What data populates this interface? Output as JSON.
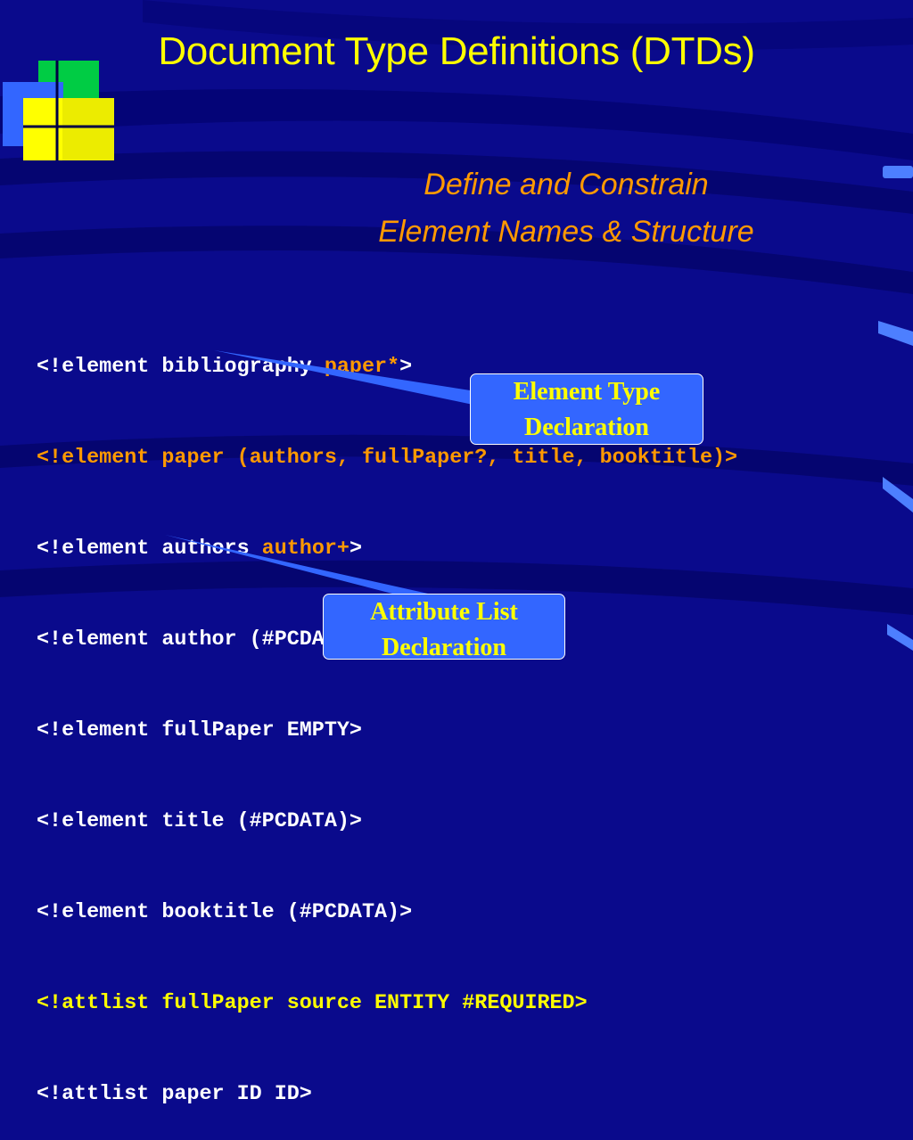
{
  "slide": {
    "title": "Document Type Definitions (DTDs)",
    "subtitle_line1": "Define and Constrain",
    "subtitle_line2": "Element Names & Structure"
  },
  "code": {
    "line1_prefix": "<!element bibliography ",
    "line1_highlight": "paper*",
    "line1_suffix": ">",
    "line2": "<!element paper (authors, fullPaper?, title, booktitle)>",
    "line3_prefix": "<!element authors ",
    "line3_highlight": "author+",
    "line3_suffix": ">",
    "line4": "<!element author (#PCDATA)>",
    "line5": "<!element fullPaper EMPTY>",
    "line6": "<!element title (#PCDATA)>",
    "line7": "<!element booktitle (#PCDATA)>",
    "line8_p1": "<!attlist fullPaper source ",
    "line8_p2": "ENTITY #REQUIRED>",
    "line9": "<!attlist paper ID ID>"
  },
  "callouts": {
    "element_type_line1": "Element Type",
    "element_type_line2": "Declaration",
    "attribute_list_line1": "Attribute List",
    "attribute_list_line2": "Declaration"
  },
  "colors": {
    "background": "#0a0a8c",
    "title": "#ffff00",
    "subtitle": "#ff9900",
    "callout_fill": "#3366ff"
  }
}
